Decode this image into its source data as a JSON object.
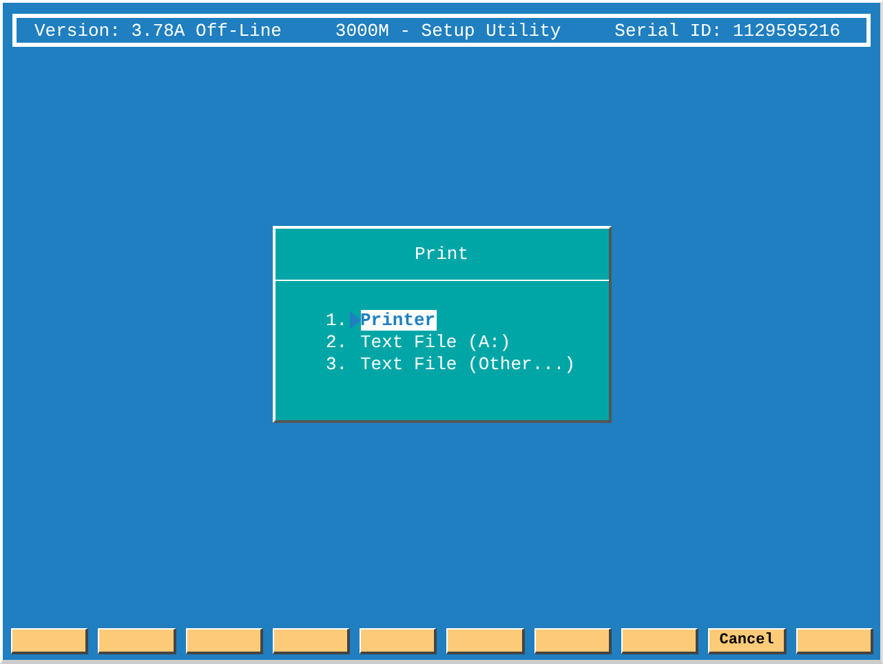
{
  "header": {
    "version": "Version: 3.78A Off-Line",
    "title": "3000M - Setup Utility",
    "serial": "Serial ID: 1129595216"
  },
  "dialog": {
    "title": "Print",
    "items": [
      {
        "number": "1.",
        "label": "Printer",
        "selected": true
      },
      {
        "number": "2.",
        "label": "Text File (A:)",
        "selected": false
      },
      {
        "number": "3.",
        "label": "Text File (Other...)",
        "selected": false
      }
    ]
  },
  "function_keys": [
    {
      "kind": "blank"
    },
    {
      "kind": "blank"
    },
    {
      "kind": "blank"
    },
    {
      "kind": "blank"
    },
    {
      "kind": "blank"
    },
    {
      "kind": "blank"
    },
    {
      "kind": "blank"
    },
    {
      "kind": "blank"
    },
    {
      "kind": "labeled",
      "label": "Cancel"
    },
    {
      "kind": "blank"
    }
  ]
}
